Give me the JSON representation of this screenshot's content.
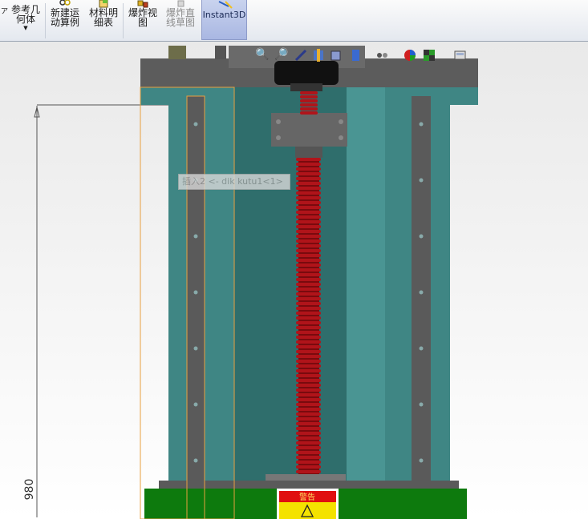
{
  "ribbon": {
    "buttons": [
      {
        "label": "参考几\n何体",
        "icon": "reference-geometry-icon",
        "disabled": false
      },
      {
        "label": "新建运\n动算例",
        "icon": "motion-study-icon",
        "disabled": false
      },
      {
        "label": "材料明\n细表",
        "icon": "bill-of-materials-icon",
        "disabled": false
      },
      {
        "label": "爆炸视\n图",
        "icon": "exploded-view-icon",
        "disabled": false
      },
      {
        "label": "爆炸直\n线草图",
        "icon": "explode-line-sketch-icon",
        "disabled": true
      }
    ],
    "instant3d": {
      "label": "Instant3D",
      "active": true
    }
  },
  "viewport": {
    "tooltip": "插入2 <- dik kutu1<1>",
    "dimension_value": "980",
    "warning_label": "警告",
    "colors": {
      "frame": "#5a5a5a",
      "frame_top": "#6b6b6b",
      "panel_teal": "#3f8684",
      "panel_teal_dark": "#2f6e6c",
      "screw_red": "#b0141a",
      "base_green": "#0d7a0d",
      "selection_orange": "#e8a040"
    }
  }
}
